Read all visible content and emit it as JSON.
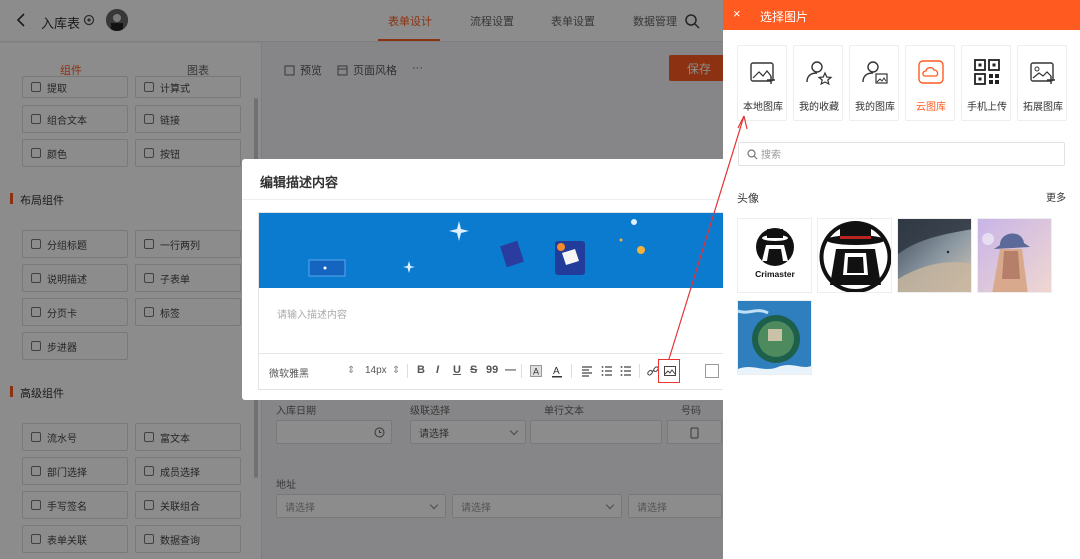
{
  "app": {
    "title": "入库表",
    "tabs": [
      "表单设计",
      "流程设置",
      "表单设置",
      "数据管理"
    ],
    "active_tab": 0
  },
  "toolbar": {
    "preview": "预览",
    "page_style": "页面风格",
    "more": "···",
    "save": "保存"
  },
  "sidebar": {
    "tabs": [
      "组件",
      "图表"
    ],
    "top_items": [
      "组合文本",
      "链接",
      "颜色",
      "按钮"
    ],
    "top_partial": [
      "提取",
      "计算式"
    ],
    "layout_group": "布局组件",
    "layout_items": [
      "分组标题",
      "一行两列",
      "说明描述",
      "子表单",
      "分页卡",
      "标签",
      "步进器"
    ],
    "advanced_group": "高级组件",
    "advanced_items": [
      "流水号",
      "富文本",
      "部门选择",
      "成员选择",
      "手写签名",
      "关联组合",
      "表单关联",
      "数据查询"
    ]
  },
  "form": {
    "labels": [
      "入库日期",
      "级联选择",
      "单行文本",
      "号码",
      "地址"
    ],
    "select_placeholder": "请选择"
  },
  "dialog": {
    "title": "编辑描述内容",
    "placeholder": "请输入描述内容",
    "font": "微软雅黑",
    "size": "14px",
    "buttons": [
      "B",
      "I",
      "U",
      "S",
      "99",
      "—"
    ]
  },
  "panel": {
    "title": "选择图片",
    "close": "×",
    "sources": [
      {
        "label": "本地图库",
        "icon": "image-upload-icon"
      },
      {
        "label": "我的收藏",
        "icon": "user-star-icon"
      },
      {
        "label": "我的图库",
        "icon": "user-image-icon"
      },
      {
        "label": "云图库",
        "icon": "cloud-icon"
      },
      {
        "label": "手机上传",
        "icon": "qrcode-icon"
      },
      {
        "label": "拓展图库",
        "icon": "image-add-icon"
      }
    ],
    "active_source": 3,
    "search_placeholder": "搜索",
    "category": "头像",
    "more": "更多",
    "thumb_caption": "Crimaster"
  },
  "colors": {
    "accent": "#ff5a1f",
    "annotation": "#e33333",
    "banner": "#0a7bcf"
  }
}
